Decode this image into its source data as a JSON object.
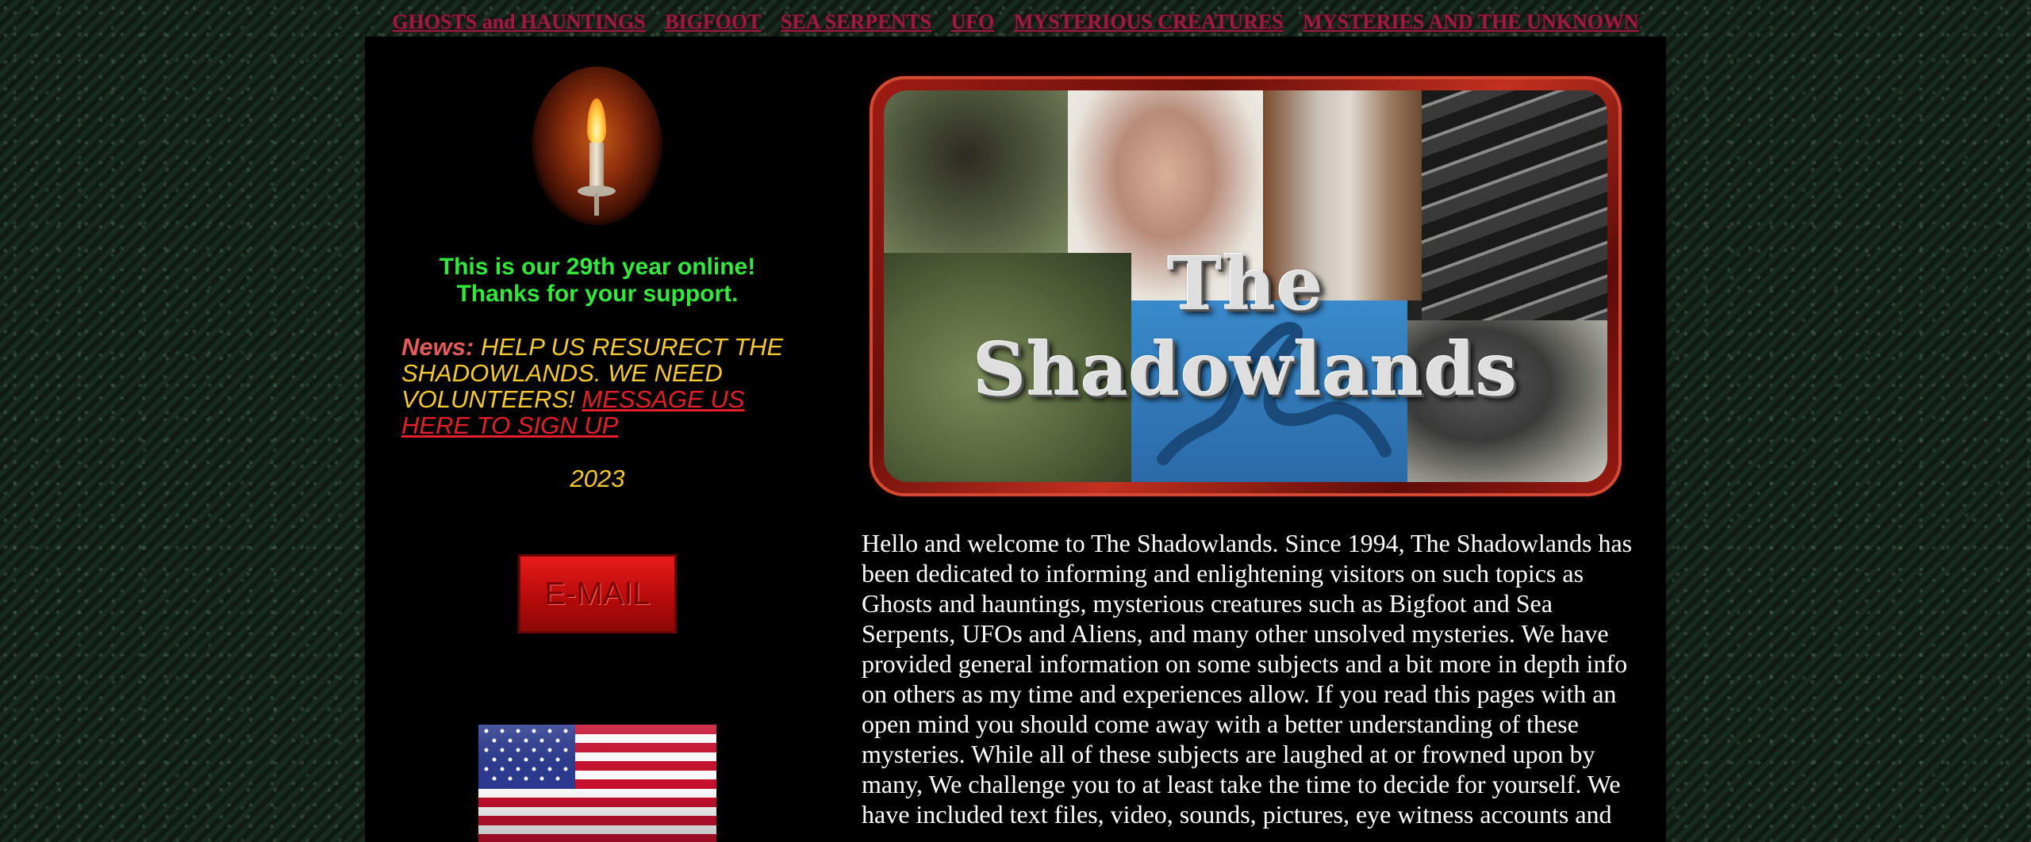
{
  "nav": {
    "items": [
      "GHOSTS and HAUNTINGS",
      "BIGFOOT",
      "SEA SERPENTS",
      "UFO",
      "MYSTERIOUS CREATURES",
      "MYSTERIES AND THE UNKNOWN"
    ]
  },
  "left": {
    "online_line1": "This is our 29th year online!",
    "online_line2": "Thanks for your support.",
    "news_label": "News:",
    "news_text": " HELP US RESURECT THE SHADOWLANDS.  WE NEED VOLUNTEERS! ",
    "news_link": "MESSAGE US HERE TO SIGN UP",
    "year": "2023",
    "email_button": "E-MAIL",
    "candle_icon": "candle-icon",
    "flag_icon": "us-flag"
  },
  "banner": {
    "title": "The Shadowlands"
  },
  "main": {
    "welcome": "Hello and welcome to The Shadowlands. Since 1994, The Shadowlands has been dedicated to informing and enlightening visitors on such topics as Ghosts and hauntings, mysterious creatures such as Bigfoot and Sea Serpents, UFOs and Aliens, and many other unsolved mysteries. We have provided general information on some subjects and a bit more in depth info on others as my time and experiences allow. If you read this pages with an open mind you should come away with a better understanding of these mysteries. While all of these subjects are laughed at or frowned upon by many, We challenge you to at least take the time to decide for yourself. We have included text files, video, sounds, pictures, eye witness accounts and"
  },
  "colors": {
    "nav_link": "#9e1a44",
    "online_green": "#33e83c",
    "news_yellow": "#f5c832",
    "news_label": "#e55a5a",
    "link_red": "#e3202a",
    "panel_bg": "#000000"
  }
}
